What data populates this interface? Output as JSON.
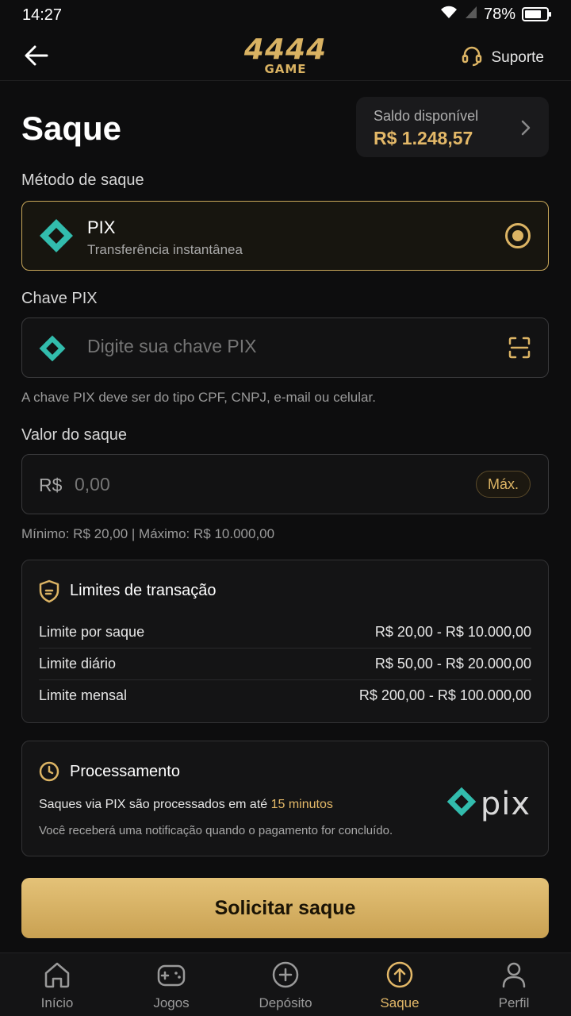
{
  "status_bar": {
    "time": "14:27",
    "battery": "78%",
    "battery_level": 0.78
  },
  "header": {
    "logo_main": "4444",
    "logo_sub": "GAME",
    "support_label": "Suporte"
  },
  "page": {
    "title": "Saque"
  },
  "balance": {
    "label": "Saldo disponível",
    "value": "R$ 1.248,57"
  },
  "method": {
    "section_label": "Método de saque",
    "name": "PIX",
    "description": "Transferência instantânea",
    "selected": true
  },
  "pix_key": {
    "label": "Chave PIX",
    "placeholder": "Digite sua chave PIX",
    "value": "",
    "helper": "A chave PIX deve ser do tipo CPF, CNPJ, e-mail ou celular."
  },
  "amount": {
    "label": "Valor do saque",
    "currency": "R$",
    "placeholder": "0,00",
    "value": "",
    "max_label": "Máx.",
    "helper": "Mínimo: R$ 20,00 | Máximo: R$ 10.000,00"
  },
  "limits": {
    "title": "Limites de transação",
    "rows": [
      {
        "label": "Limite por saque",
        "value": "R$ 20,00 - R$ 10.000,00"
      },
      {
        "label": "Limite diário",
        "value": "R$ 50,00 - R$ 20.000,00"
      },
      {
        "label": "Limite mensal",
        "value": "R$ 200,00 - R$ 100.000,00"
      }
    ]
  },
  "processing": {
    "title": "Processamento",
    "line1_prefix": "Saques via PIX são processados em até ",
    "line1_highlight": "15 minutos",
    "line2": "Você receberá uma notificação quando o pagamento for concluído.",
    "logo_text": "pix"
  },
  "submit": {
    "label": "Solicitar saque"
  },
  "nav": {
    "items": [
      {
        "label": "Início",
        "icon": "home-icon",
        "active": false
      },
      {
        "label": "Jogos",
        "icon": "gamepad-icon",
        "active": false
      },
      {
        "label": "Depósito",
        "icon": "plus-circle-icon",
        "active": false
      },
      {
        "label": "Saque",
        "icon": "upload-circle-icon",
        "active": true
      },
      {
        "label": "Perfil",
        "icon": "user-icon",
        "active": false
      }
    ]
  },
  "colors": {
    "accent": "#e3b868",
    "pix_teal": "#32bcad",
    "background": "#0d0d0e"
  }
}
